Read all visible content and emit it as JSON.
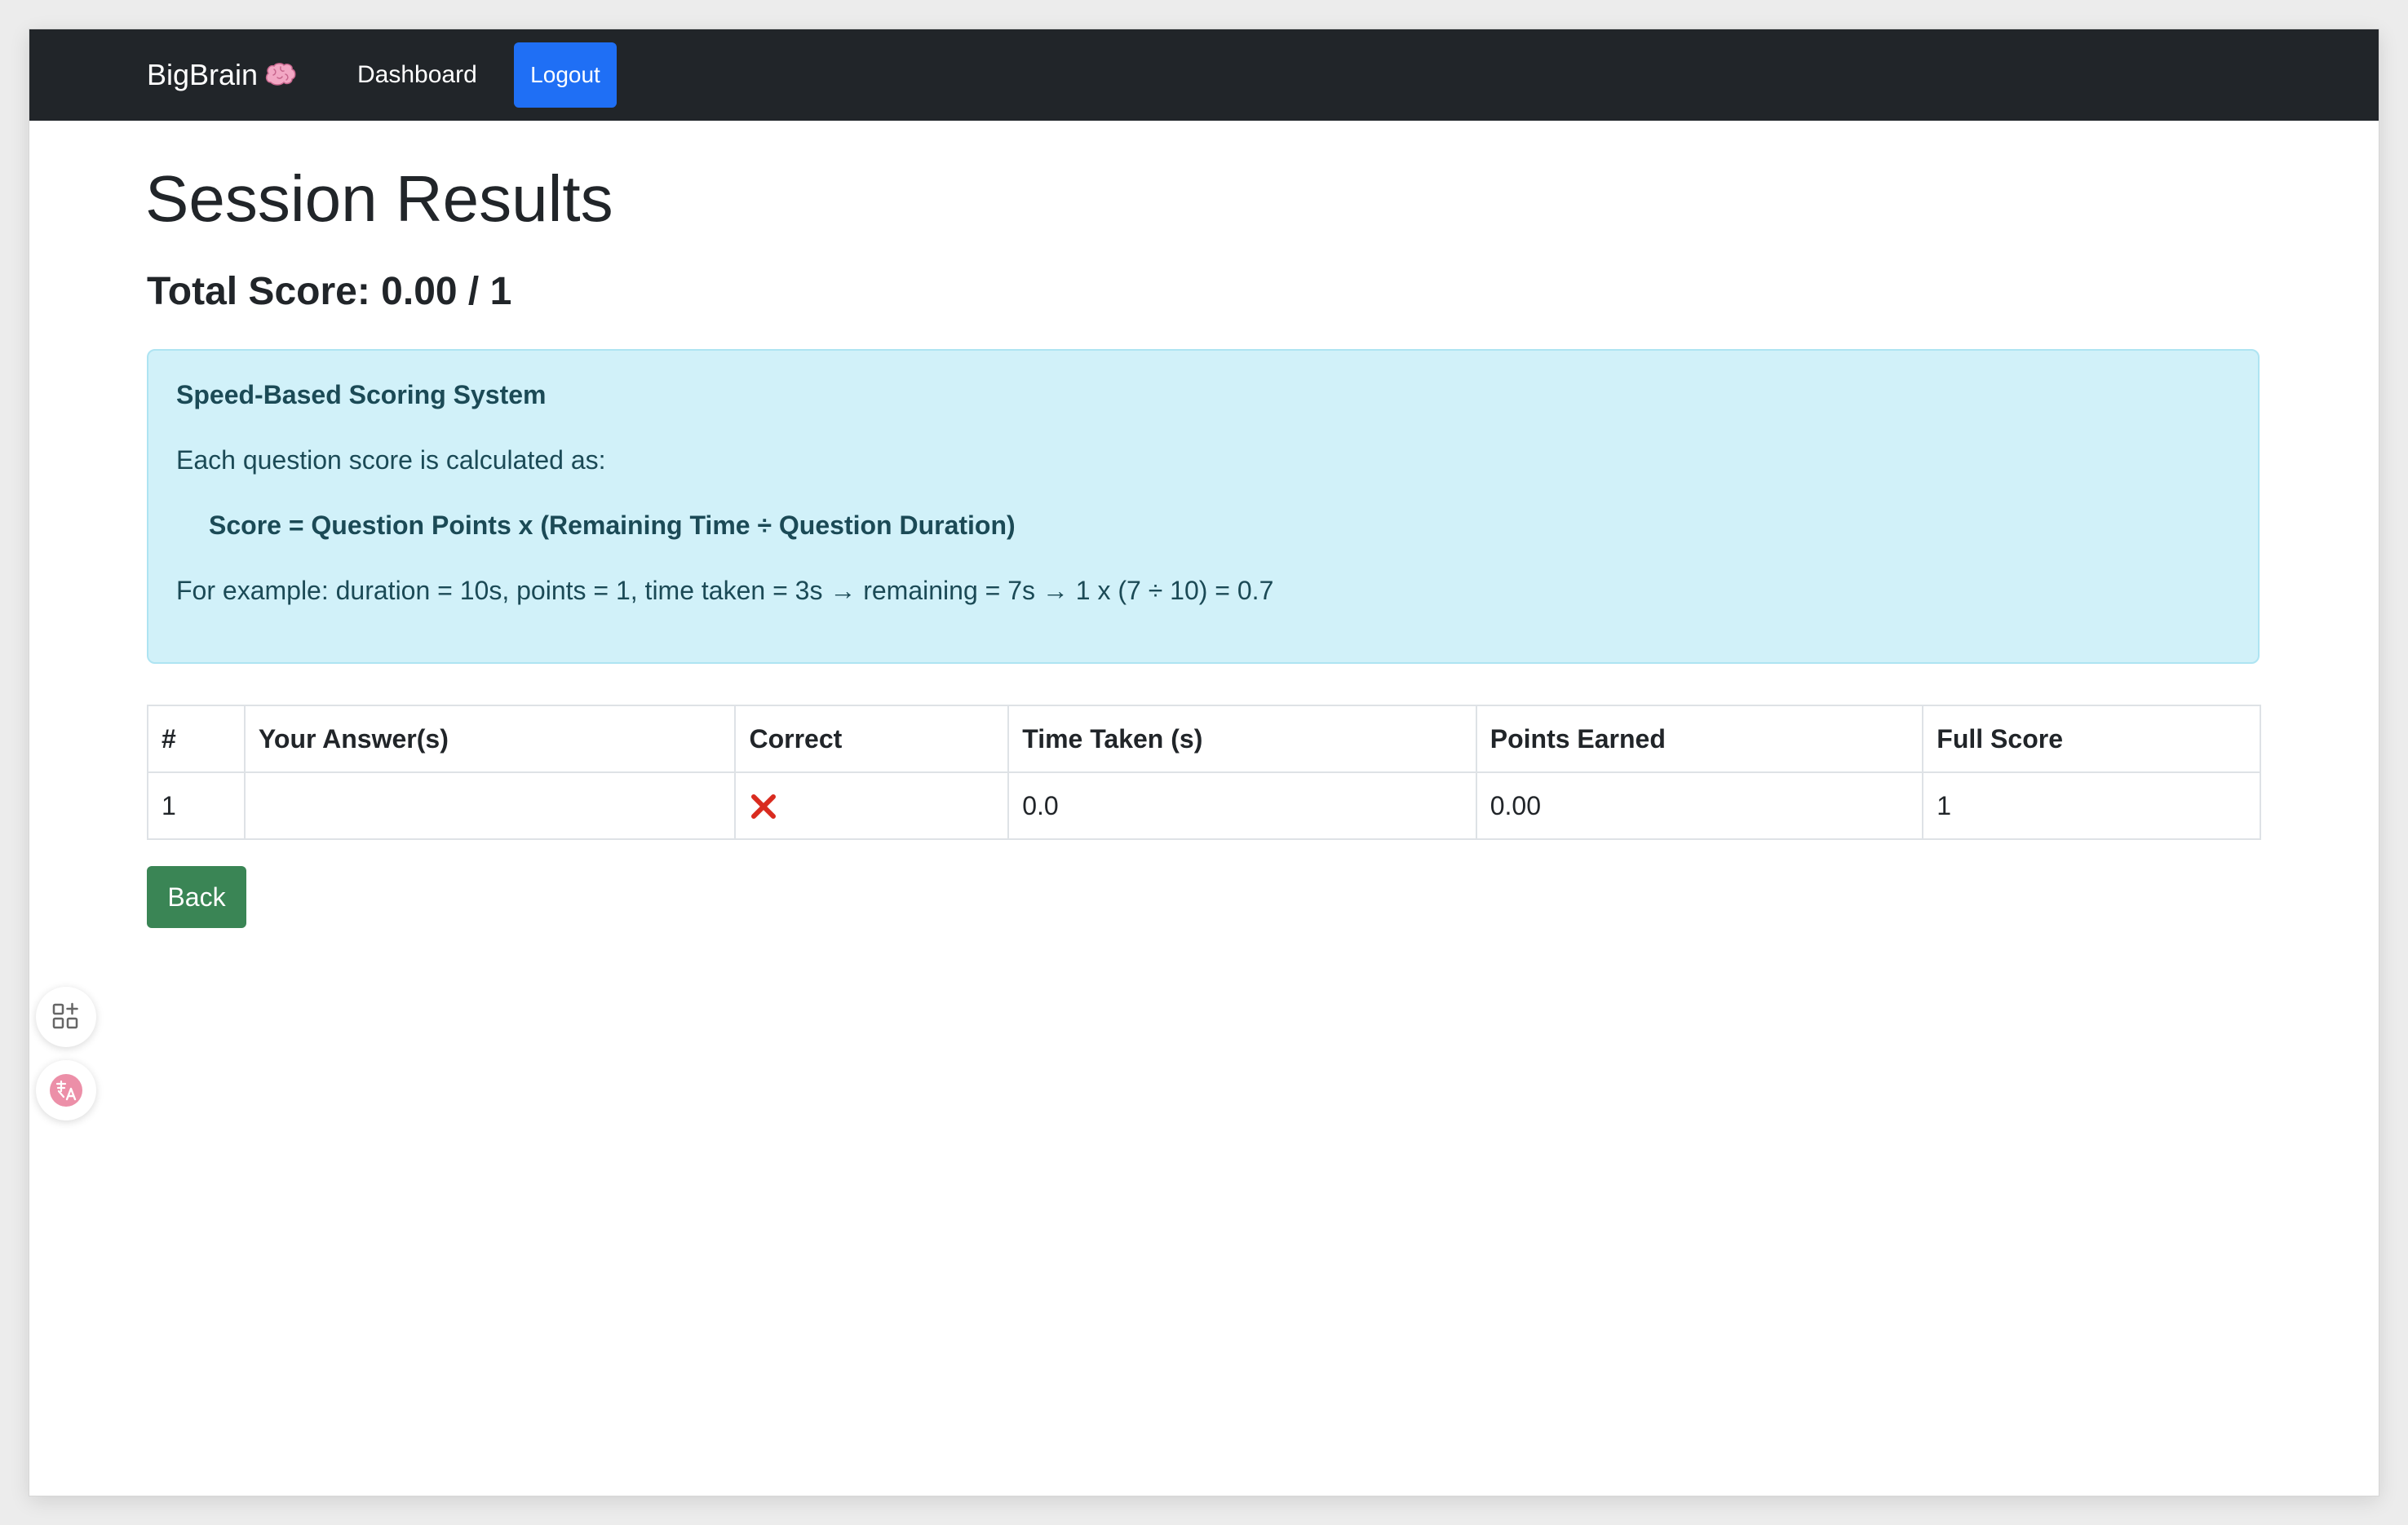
{
  "navbar": {
    "brand": "BigBrain",
    "brand_icon": "brain-emoji",
    "dashboard_label": "Dashboard",
    "logout_label": "Logout",
    "bg_color": "#212529",
    "logout_color": "#1f6ff5"
  },
  "main": {
    "title": "Session Results",
    "total_score": "Total Score: 0.00 / 1"
  },
  "info": {
    "title": "Speed-Based Scoring System",
    "line1": "Each question score is calculated as:",
    "formula": "Score = Question Points x (Remaining Time ÷ Question Duration)",
    "example": "For example: duration = 10s, points = 1, time taken = 3s → remaining = 7s → 1 x (7 ÷ 10) = 0.7",
    "bg_color": "#d1f1f9"
  },
  "table": {
    "headers": [
      "#",
      "Your Answer(s)",
      "Correct",
      "Time Taken (s)",
      "Points Earned",
      "Full Score"
    ],
    "rows": [
      {
        "index": "1",
        "answers": "",
        "correct_icon": "cross-mark-icon",
        "time_taken": "0.0",
        "points_earned": "0.00",
        "full_score": "1"
      }
    ]
  },
  "back_label": "Back",
  "back_color": "#3a8555",
  "floating": {
    "icons": [
      "apps-plus-icon",
      "translate-icon"
    ]
  }
}
